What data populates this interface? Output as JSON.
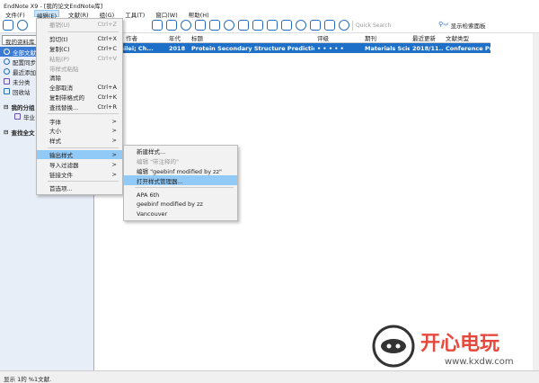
{
  "title": "EndNote X9 - [我的论文EndNote库]",
  "menubar": [
    "文件(F)",
    "编辑(E)",
    "文献(R)",
    "组(G)",
    "工具(T)",
    "窗口(W)",
    "帮助(H)"
  ],
  "search": {
    "placeholder": "Quick Search",
    "show_panel": "显示检索面板"
  },
  "sidebar": {
    "header": "我的资料库",
    "items": [
      "全部文献",
      "配置同步...",
      "最近添加",
      "未分类",
      "回收站"
    ],
    "group_title": "我的分组",
    "group_items": [
      "毕业"
    ],
    "find_full_text": "查找全文"
  },
  "table": {
    "headers": [
      "作者",
      "年代",
      "标题",
      "评级",
      "期刊",
      "最近更新",
      "文献类型"
    ],
    "rows": [
      [
        "...ng, Leilei; Ch...",
        "2018",
        "Protein Secondary Structure Prediction Using ...",
        "• • • • •",
        "Materials Scien...",
        "2018/11...",
        "Conference Pr..."
      ]
    ]
  },
  "edit_menu": [
    {
      "label": "撤销(U)",
      "shortcut": "Ctrl+Z",
      "disabled": true
    },
    {
      "label": "剪切(t)",
      "shortcut": "Ctrl+X"
    },
    {
      "label": "复制(C)",
      "shortcut": "Ctrl+C"
    },
    {
      "label": "粘贴(P)",
      "shortcut": "Ctrl+V",
      "disabled": true
    },
    {
      "label": "带样式粘贴",
      "shortcut": "",
      "disabled": true
    },
    {
      "label": "清除",
      "shortcut": ""
    },
    {
      "label": "全部取消",
      "shortcut": "Ctrl+A"
    },
    {
      "label": "复制带格式的",
      "shortcut": "Ctrl+K"
    },
    {
      "label": "查找替换...",
      "shortcut": "Ctrl+R"
    },
    {
      "label": "字体",
      "shortcut": ">"
    },
    {
      "label": "大小",
      "shortcut": ">"
    },
    {
      "label": "样式",
      "shortcut": ">"
    },
    {
      "label": "输出样式",
      "shortcut": ">"
    },
    {
      "label": "导入过滤器",
      "shortcut": ">"
    },
    {
      "label": "链接文件",
      "shortcut": ">"
    },
    {
      "label": "首选项...",
      "shortcut": ""
    }
  ],
  "submenu": [
    "新建样式...",
    "编辑 \"带注释的\"",
    "编辑 \"geebinf modified by zz\"",
    "打开样式管理器...",
    "APA 6th",
    "geebinf modified by zz",
    "Vancouver"
  ],
  "status": "显示 1的 %1文献.",
  "watermark": {
    "name": "开心电玩",
    "url": "www.kxdw.com"
  }
}
